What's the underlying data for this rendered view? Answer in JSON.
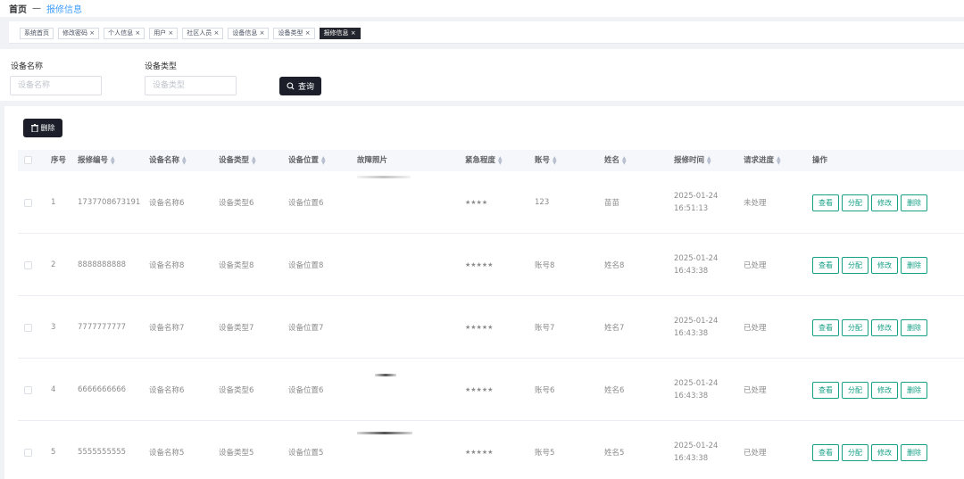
{
  "breadcrumb": {
    "home": "首页",
    "sep": "—",
    "current": "报修信息"
  },
  "tabs": [
    {
      "label": "系统首页",
      "closable": false,
      "active": false
    },
    {
      "label": "修改密码 ×",
      "closable": true,
      "active": false
    },
    {
      "label": "个人信息 ×",
      "closable": true,
      "active": false
    },
    {
      "label": "用户 ×",
      "closable": true,
      "active": false
    },
    {
      "label": "社区人员 ×",
      "closable": true,
      "active": false
    },
    {
      "label": "设备信息 ×",
      "closable": true,
      "active": false
    },
    {
      "label": "设备类型 ×",
      "closable": true,
      "active": false
    },
    {
      "label": "报修信息 ×",
      "closable": true,
      "active": true
    }
  ],
  "search": {
    "name_label": "设备名称",
    "name_placeholder": "设备名称",
    "type_label": "设备类型",
    "type_placeholder": "设备类型",
    "query_label": "查询"
  },
  "toolbar": {
    "delete_label": "删除"
  },
  "table": {
    "headers": {
      "index": "序号",
      "code": "报修编号",
      "name": "设备名称",
      "type": "设备类型",
      "location": "设备位置",
      "photo": "故障照片",
      "urgency": "紧急程度",
      "account": "账号",
      "person": "姓名",
      "time": "报修时间",
      "progress": "请求进度",
      "actions": "操作"
    },
    "action_labels": {
      "view": "查看",
      "assign": "分配",
      "edit": "修改",
      "delete": "删除"
    },
    "rows": [
      {
        "index": "1",
        "code": "1737708673191",
        "name": "设备名称6",
        "type": "设备类型6",
        "location": "设备位置6",
        "urgency": "★★★★",
        "account": "123",
        "person": "苗苗",
        "time": "2025-01-24 16:51:13",
        "progress": "未处理"
      },
      {
        "index": "2",
        "code": "8888888888",
        "name": "设备名称8",
        "type": "设备类型8",
        "location": "设备位置8",
        "urgency": "★★★★★",
        "account": "账号8",
        "person": "姓名8",
        "time": "2025-01-24 16:43:38",
        "progress": "已处理"
      },
      {
        "index": "3",
        "code": "7777777777",
        "name": "设备名称7",
        "type": "设备类型7",
        "location": "设备位置7",
        "urgency": "★★★★★",
        "account": "账号7",
        "person": "姓名7",
        "time": "2025-01-24 16:43:38",
        "progress": "已处理"
      },
      {
        "index": "4",
        "code": "6666666666",
        "name": "设备名称6",
        "type": "设备类型6",
        "location": "设备位置6",
        "urgency": "★★★★★",
        "account": "账号6",
        "person": "姓名6",
        "time": "2025-01-24 16:43:38",
        "progress": "已处理"
      },
      {
        "index": "5",
        "code": "5555555555",
        "name": "设备名称5",
        "type": "设备类型5",
        "location": "设备位置5",
        "urgency": "★★★★★",
        "account": "账号5",
        "person": "姓名5",
        "time": "2025-01-24 16:43:38",
        "progress": "已处理"
      }
    ]
  },
  "colors": {
    "accent": "#409eff",
    "dark_button": "#1c1f2a",
    "action_green": "#16a085"
  },
  "icons": {
    "query": "search-icon",
    "delete": "trash-icon",
    "sort": "sort-caret-icon"
  }
}
